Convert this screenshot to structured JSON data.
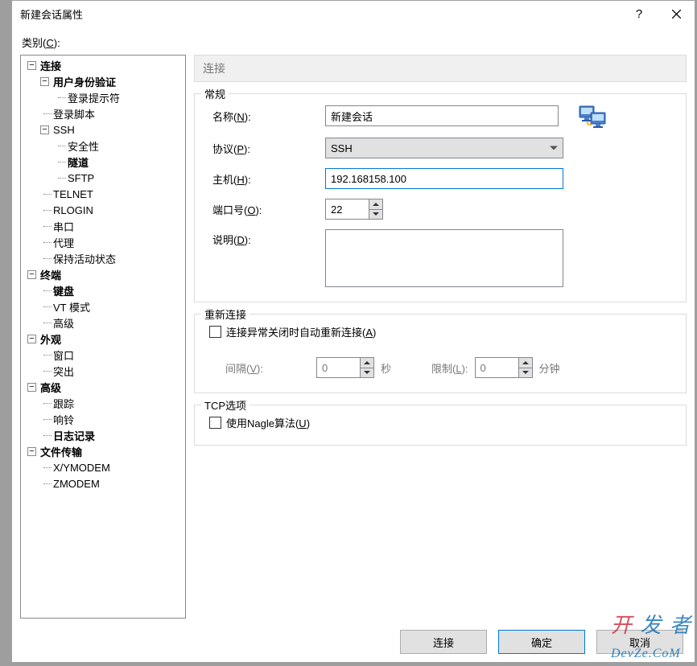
{
  "window": {
    "title": "新建会话属性",
    "help": "?"
  },
  "category_label": "类别(C):",
  "tree": {
    "connection": "连接",
    "user_auth": "用户身份验证",
    "login_prompt": "登录提示符",
    "login_script": "登录脚本",
    "ssh": "SSH",
    "security": "安全性",
    "tunnel": "隧道",
    "sftp": "SFTP",
    "telnet": "TELNET",
    "rlogin": "RLOGIN",
    "serial": "串口",
    "proxy": "代理",
    "keepalive": "保持活动状态",
    "terminal": "终端",
    "keyboard": "键盘",
    "vtmode": "VT 模式",
    "advanced_t": "高级",
    "appearance": "外观",
    "window": "窗口",
    "highlight": "突出",
    "advanced": "高级",
    "trace": "跟踪",
    "bell": "响铃",
    "logging": "日志记录",
    "filetransfer": "文件传输",
    "xymodem": "X/YMODEM",
    "zmodem": "ZMODEM"
  },
  "panel_title": "连接",
  "general": {
    "legend": "常规",
    "name_label": "名称(N):",
    "name_value": "新建会话",
    "protocol_label": "协议(P):",
    "protocol_value": "SSH",
    "host_label": "主机(H):",
    "host_value": "192.168158.100",
    "port_label": "端口号(O):",
    "port_value": "22",
    "desc_label": "说明(D):",
    "desc_value": ""
  },
  "reconnect": {
    "legend": "重新连接",
    "checkbox_label": "连接异常关闭时自动重新连接(A)",
    "interval_label": "间隔(V):",
    "interval_value": "0",
    "interval_unit": "秒",
    "limit_label": "限制(L):",
    "limit_value": "0",
    "limit_unit": "分钟"
  },
  "tcp": {
    "legend": "TCP选项",
    "nagle_label": "使用Nagle算法(U)"
  },
  "buttons": {
    "connect": "连接",
    "ok": "确定",
    "cancel": "取消"
  },
  "watermark": "开发者",
  "watermark_sub": "DevZe.CoM",
  "expander_minus": "⊟",
  "expander_minus2": "−"
}
